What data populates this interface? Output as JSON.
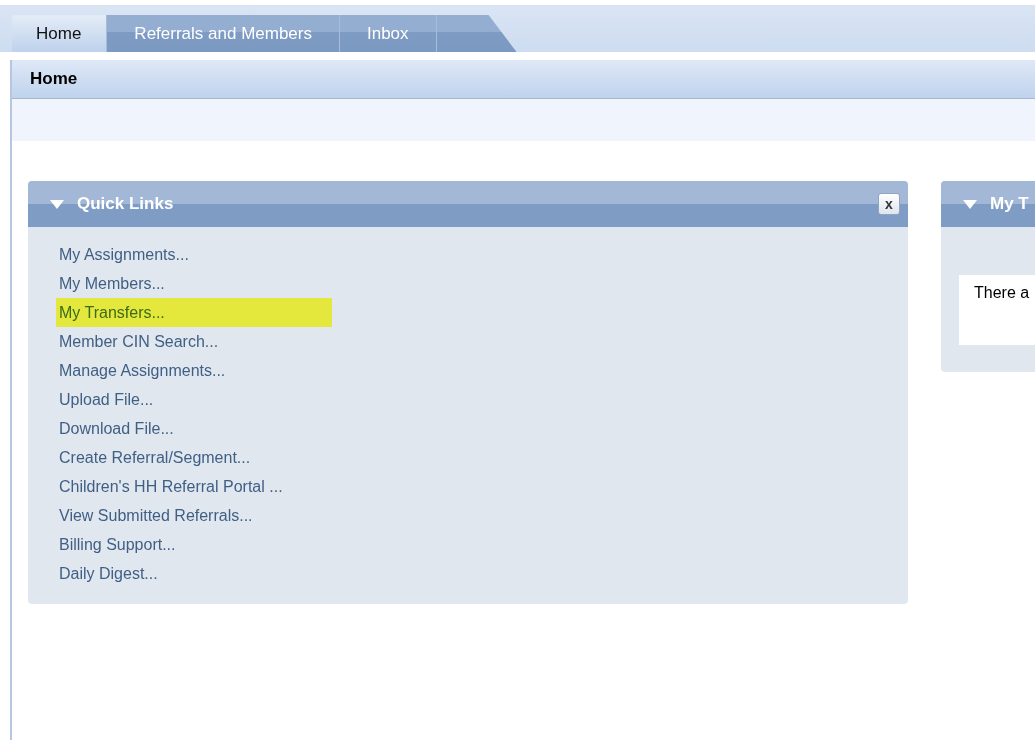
{
  "tabs": [
    {
      "label": "Home",
      "selected": true
    },
    {
      "label": "Referrals and Members",
      "selected": false
    },
    {
      "label": "Inbox",
      "selected": false
    }
  ],
  "page_title": "Home",
  "quick_links": {
    "title": "Quick Links",
    "expanded": true,
    "close_label": "x",
    "links": [
      {
        "label": "My Assignments...",
        "highlighted": false
      },
      {
        "label": "My Members...",
        "highlighted": false
      },
      {
        "label": "My Transfers...",
        "highlighted": true
      },
      {
        "label": "Member CIN Search...",
        "highlighted": false
      },
      {
        "label": "Manage Assignments...",
        "highlighted": false
      },
      {
        "label": "Upload File...",
        "highlighted": false
      },
      {
        "label": "Download File...",
        "highlighted": false
      },
      {
        "label": "Create Referral/Segment...",
        "highlighted": false
      },
      {
        "label": "Children's HH Referral Portal ...",
        "highlighted": false
      },
      {
        "label": "View Submitted Referrals...",
        "highlighted": false
      },
      {
        "label": "Billing Support...",
        "highlighted": false
      },
      {
        "label": "Daily Digest...",
        "highlighted": false
      }
    ]
  },
  "side_panel": {
    "title": "My T",
    "expanded": true,
    "message": "There a"
  }
}
